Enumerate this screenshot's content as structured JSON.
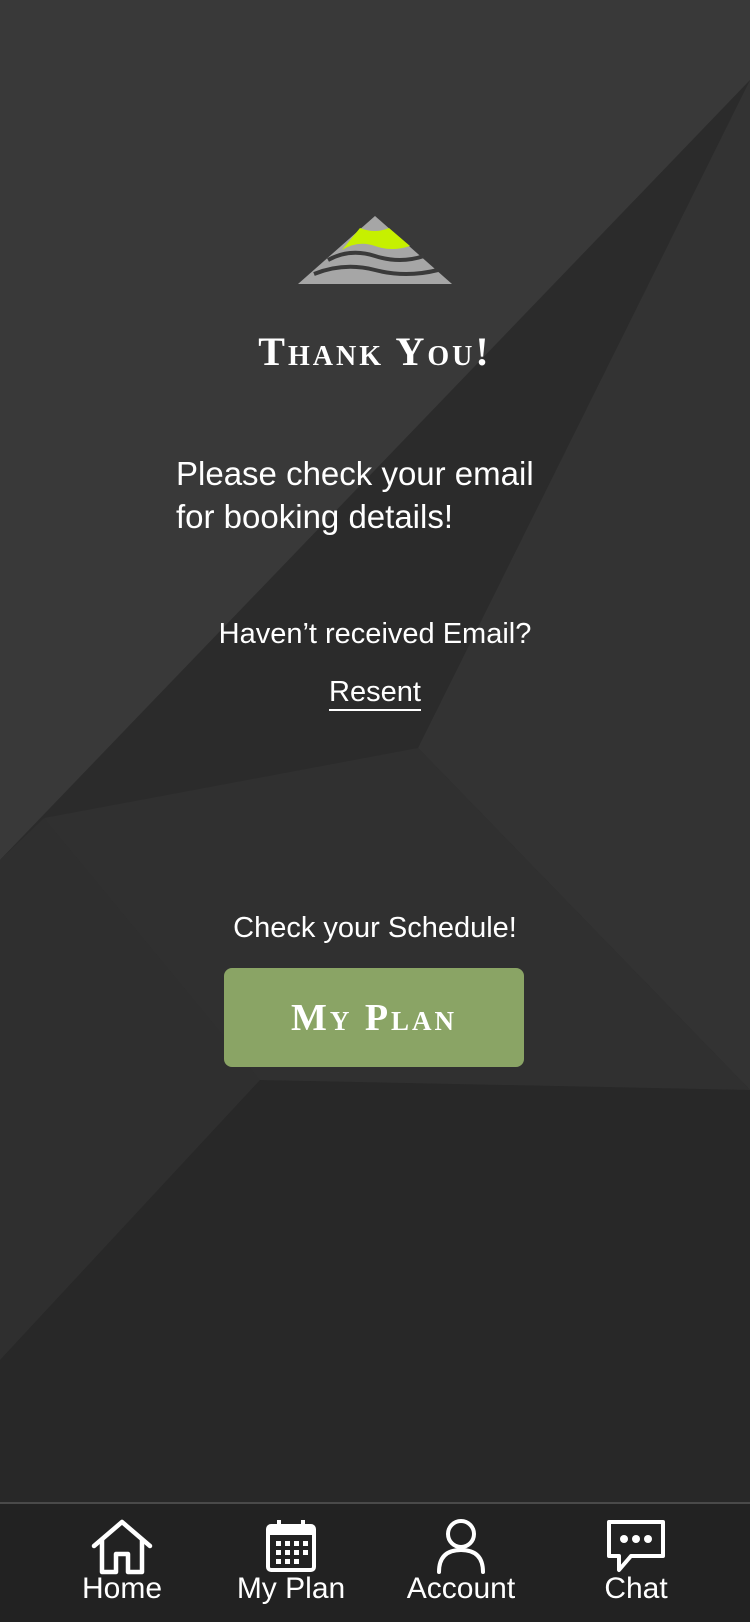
{
  "main": {
    "title": "Thank You!",
    "email_note_line1": "Please check your email",
    "email_note_line2": "for booking details!",
    "not_received": "Haven’t received Email?",
    "resent_link": "Resent",
    "schedule_note": "Check your Schedule!",
    "myplan_button": "My Plan"
  },
  "tabbar": {
    "items": [
      {
        "label": "Home",
        "icon": "home-icon"
      },
      {
        "label": "My Plan",
        "icon": "calendar-icon"
      },
      {
        "label": "Account",
        "icon": "person-icon"
      },
      {
        "label": "Chat",
        "icon": "chat-bubble-icon"
      }
    ]
  },
  "colors": {
    "background": "#2a2a2a",
    "accent_button": "#8aa465",
    "logo_lime": "#c6f000",
    "logo_gray": "#a6a6a6",
    "tabbar_bg": "#222222"
  }
}
